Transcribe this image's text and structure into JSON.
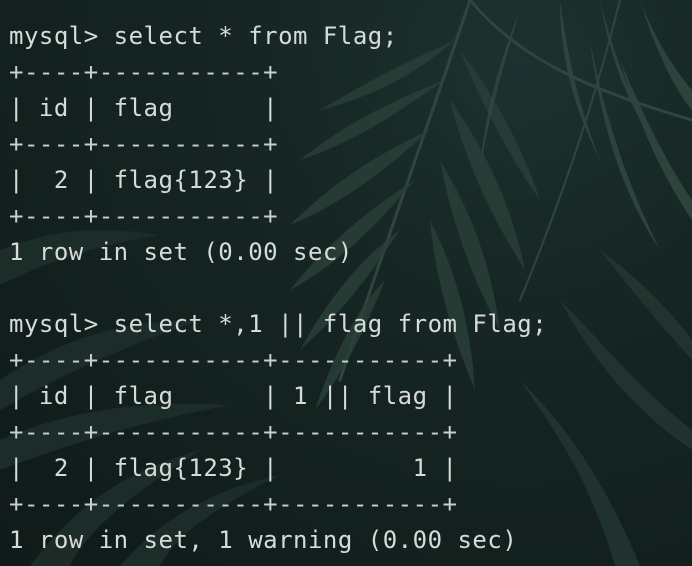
{
  "terminal": {
    "lines": [
      {
        "text": "mysql> select * from Flag;",
        "kind": "prompt"
      },
      {
        "text": "+----+-----------+",
        "kind": "border"
      },
      {
        "text": "| id | flag      |",
        "kind": "row"
      },
      {
        "text": "+----+-----------+",
        "kind": "border"
      },
      {
        "text": "|  2 | flag{123} |",
        "kind": "row"
      },
      {
        "text": "+----+-----------+",
        "kind": "border"
      },
      {
        "text": "1 row in set (0.00 sec)",
        "kind": "status"
      },
      {
        "text": "",
        "kind": "blank"
      },
      {
        "text": "mysql> select *,1 || flag from Flag;",
        "kind": "prompt"
      },
      {
        "text": "+----+-----------+-----------+",
        "kind": "border"
      },
      {
        "text": "| id | flag      | 1 || flag |",
        "kind": "row"
      },
      {
        "text": "+----+-----------+-----------+",
        "kind": "border"
      },
      {
        "text": "|  2 | flag{123} |         1 |",
        "kind": "row"
      },
      {
        "text": "+----+-----------+-----------+",
        "kind": "border"
      },
      {
        "text": "1 row in set, 1 warning (0.00 sec)",
        "kind": "status"
      }
    ]
  },
  "colors": {
    "text": "#d6dbda",
    "background": "#13201f",
    "leaf": "#2b4039"
  }
}
